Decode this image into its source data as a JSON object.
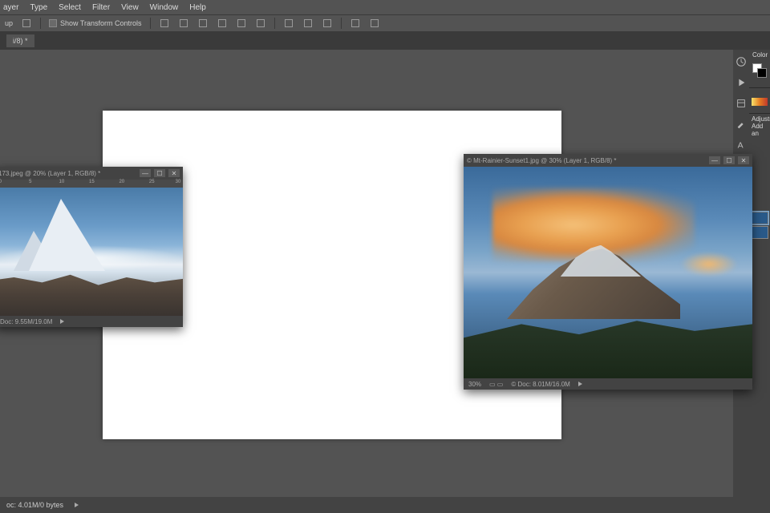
{
  "menu": {
    "items": [
      "ayer",
      "Type",
      "Select",
      "Filter",
      "View",
      "Window",
      "Help"
    ]
  },
  "options": {
    "group_label": "up",
    "show_transform": "Show Transform Controls"
  },
  "doc_tab": "i/8) *",
  "right": {
    "color_tab": "Color",
    "adjust_tab": "Adjustm",
    "adjust_sub": "Add an"
  },
  "win1": {
    "title": "173.jpeg @ 20% (Layer 1, RGB/8) *",
    "ruler": [
      "0",
      "5",
      "10",
      "15",
      "20",
      "25",
      "30"
    ],
    "status_doc": "Doc: 9.55M/19.0M"
  },
  "win2": {
    "title": "© Mt-Rainier-Sunset1.jpg @ 30% (Layer 1, RGB/8) *",
    "zoom": "30%",
    "status_doc": "© Doc: 8.01M/16.0M"
  },
  "status": {
    "doc": "oc: 4.01M/0 bytes"
  }
}
